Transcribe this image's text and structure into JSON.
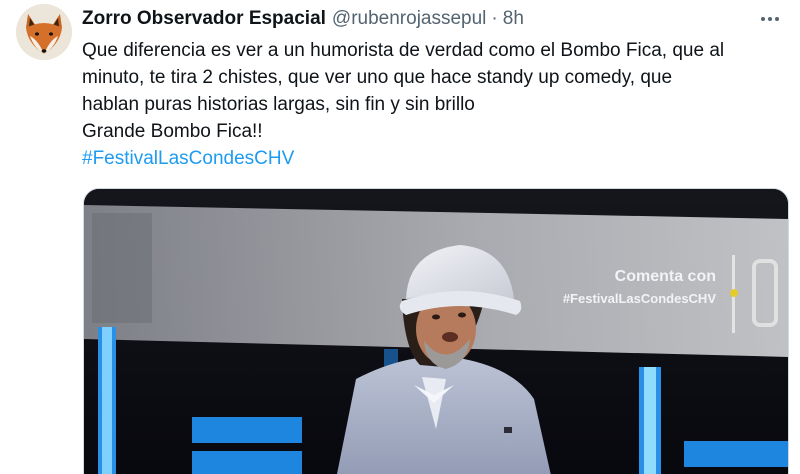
{
  "tweet": {
    "display_name": "Zorro Observador Espacial",
    "handle": "@rubenrojassepul",
    "separator": "·",
    "time": "8h",
    "text_lines": [
      "Que diferencia es ver a un humorista de verdad como el Bombo Fica, que al",
      "minuto, te tira 2 chistes, que ver uno que hace standy up comedy, que",
      "hablan puras historias largas, sin fin y sin brillo",
      "Grande Bombo Fica!!"
    ],
    "hashtag": "#FestivalLasCondesCHV"
  },
  "media": {
    "screen_text_line1": "Comenta con",
    "screen_text_line2": "#FestivalLasCondesCHV"
  },
  "icons": {
    "avatar": "fox-avatar",
    "more": "more-horizontal-icon"
  },
  "colors": {
    "link": "#1d9bf0",
    "secondary_text": "#536471",
    "primary_text": "#0f1419"
  }
}
